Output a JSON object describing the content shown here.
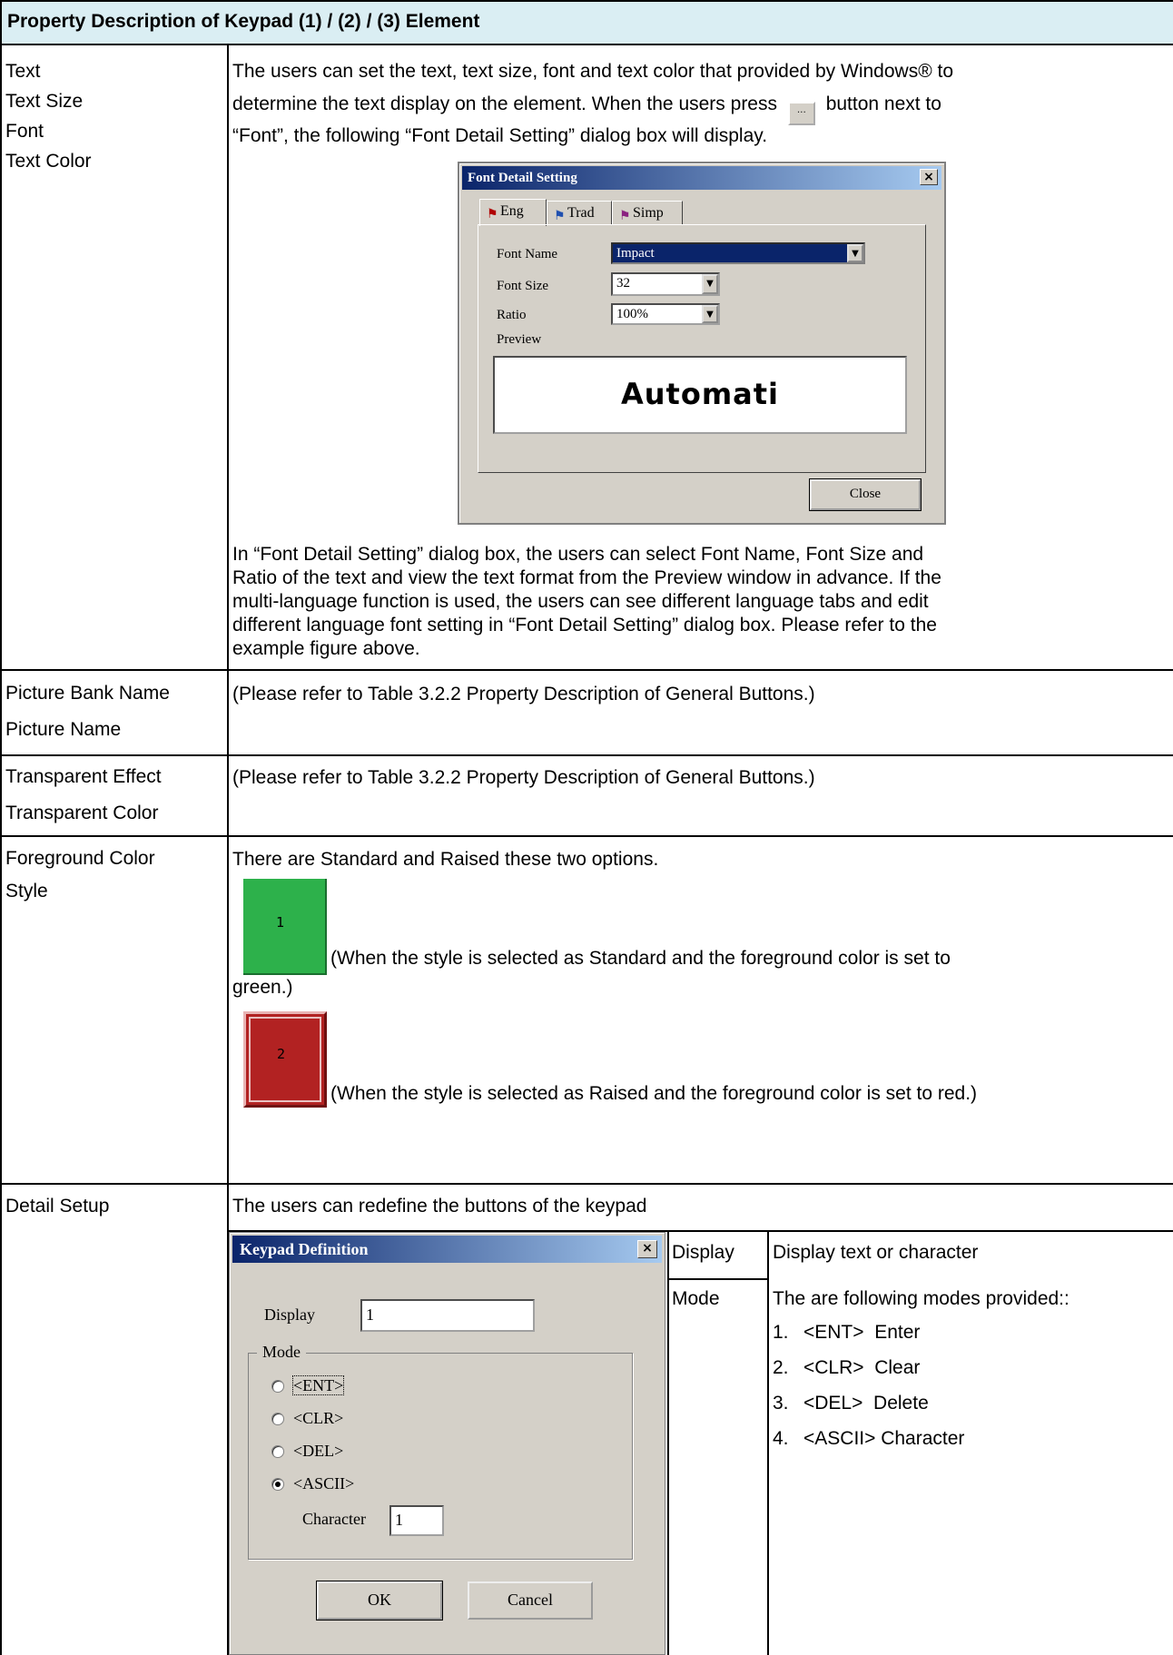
{
  "header": {
    "title": "Property Description of Keypad (1) / (2) / (3) Element"
  },
  "rows": {
    "text": {
      "props": [
        "Text",
        "Text Size",
        "Font",
        "Text Color"
      ],
      "desc_line1": "The users can set the text, text size, font and text color that provided by Windows® to",
      "desc_line2a": "determine the text display on the element. When the users press",
      "desc_line2b": "button next to",
      "desc_line3": "“Font”, the following “Font Detail Setting” dialog box will display.",
      "ellipsis_button": "...",
      "after": [
        "In “Font Detail Setting” dialog box, the users can select Font Name, Font Size and",
        "Ratio of the text and view the text format from the Preview window in advance. If the",
        "multi-language function is used, the users can see different language tabs and edit",
        "different language font setting in “Font Detail Setting” dialog box. Please refer to the",
        "example figure above."
      ]
    },
    "picture": {
      "props": [
        "Picture Bank Name",
        "Picture Name"
      ],
      "desc": "(Please refer to Table 3.2.2 Property Description of General Buttons.)"
    },
    "transparent": {
      "props": [
        "Transparent Effect",
        "Transparent Color"
      ],
      "desc": "(Please refer to Table 3.2.2 Property Description of General Buttons.)"
    },
    "foreground": {
      "props": [
        "Foreground Color",
        "Style"
      ],
      "desc": "There are Standard and Raised these two options.",
      "standard_key": "1",
      "standard_caption_a": "(When the style is selected as Standard and the foreground color is set to",
      "standard_caption_b": "green.)",
      "raised_key": "2",
      "raised_caption": "(When the style is selected as Raised and the foreground color is set to red.)",
      "colors": {
        "green": "#2db14b",
        "red": "#b22222"
      }
    },
    "detail": {
      "prop": "Detail Setup",
      "desc": "The users can redefine the buttons of the keypad",
      "display_label": "Display",
      "display_desc": "Display text or character",
      "mode_label": "Mode",
      "mode_desc": "The are following modes provided::",
      "modes": [
        {
          "num": "1.",
          "text": "<ENT>  Enter"
        },
        {
          "num": "2.",
          "text": "<CLR>  Clear"
        },
        {
          "num": "3.",
          "text": "<DEL>  Delete"
        },
        {
          "num": "4.",
          "text": "<ASCII> Character"
        }
      ]
    }
  },
  "font_dialog": {
    "title": "Font Detail Setting",
    "close_x": "×",
    "tabs": [
      "Eng",
      "Trad",
      "Simp"
    ],
    "font_name_label": "Font Name",
    "font_name_value": "Impact",
    "font_size_label": "Font Size",
    "font_size_value": "32",
    "ratio_label": "Ratio",
    "ratio_value": "100%",
    "preview_label": "Preview",
    "preview_text": "Automati",
    "close_button": "Close"
  },
  "keypad_dialog": {
    "title": "Keypad Definition",
    "close_x": "×",
    "display_label": "Display",
    "display_value": "1",
    "mode_group": "Mode",
    "options": [
      "<ENT>",
      "<CLR>",
      "<DEL>",
      "<ASCII>"
    ],
    "selected": "<ASCII>",
    "character_label": "Character",
    "character_value": "1",
    "ok": "OK",
    "cancel": "Cancel"
  }
}
